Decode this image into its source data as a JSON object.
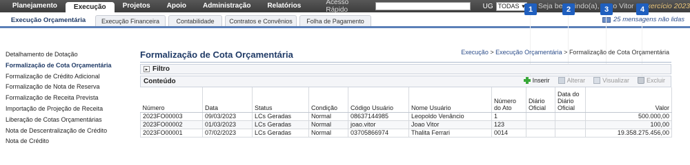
{
  "topbar": {
    "menus": [
      "Planejamento",
      "Execução",
      "Projetos",
      "Apoio",
      "Administração",
      "Relatórios"
    ],
    "quick_access_label": "Acesso Rápido",
    "ug_label": "UG",
    "ug_value": "TODAS",
    "welcome": "Seja bem-vindo(a), Joao Vitor",
    "exercise": "Exercício 2023"
  },
  "subtabs": [
    "Execução Orçamentária",
    "Execução Financeira",
    "Contabilidade",
    "Contratos e Convênios",
    "Folha de Pagamento"
  ],
  "messages": "25 mensagens não lidas",
  "sidebar": {
    "items": [
      "Detalhamento de Dotação",
      "Formalização de Cota Orçamentária",
      "Formalização de Crédito Adicional",
      "Formalização de Nota de Reserva",
      "Formalização de Receita Prevista",
      "Importação de Projeção de Receita",
      "Liberação de Cotas Orçamentárias",
      "Nota de Descentralização de Crédito",
      "Nota de Crédito"
    ]
  },
  "page": {
    "title": "Formalização de Cota Orçamentária",
    "breadcrumb": [
      "Execução",
      "Execução Orçamentária",
      "Formalização de Cota Orçamentária"
    ],
    "filter_label": "Filtro",
    "content_label": "Conteúdo"
  },
  "actions": {
    "insert": "Inserir",
    "edit": "Alterar",
    "view": "Visualizar",
    "delete": "Excluir"
  },
  "markers": [
    "1",
    "2",
    "3",
    "4"
  ],
  "table": {
    "headers": [
      "Número",
      "Data",
      "Status",
      "Condição",
      "Código Usuário",
      "Nome Usuário",
      "Número do Ato",
      "Diário Oficial",
      "Data do Diário Oficial",
      "Valor"
    ],
    "rows": [
      [
        "2023FO00003",
        "09/03/2023",
        "LCs Geradas",
        "Normal",
        "08637144985",
        "Leopoldo Venâncio",
        "1",
        "",
        "",
        "500.000,00"
      ],
      [
        "2023FO00002",
        "01/03/2023",
        "LCs Geradas",
        "Normal",
        "joao.vitor",
        "Joao Vitor",
        "123",
        "",
        "",
        "100,00"
      ],
      [
        "2023FO00001",
        "07/02/2023",
        "LCs Geradas",
        "Normal",
        "03705866974",
        "Thalita Ferrari",
        "0014",
        "",
        "",
        "19.358.275.456,00"
      ]
    ]
  },
  "colors": {
    "accent": "#1f3a66",
    "marker": "#1f5fbf",
    "topbar": "#4a4a4a"
  }
}
